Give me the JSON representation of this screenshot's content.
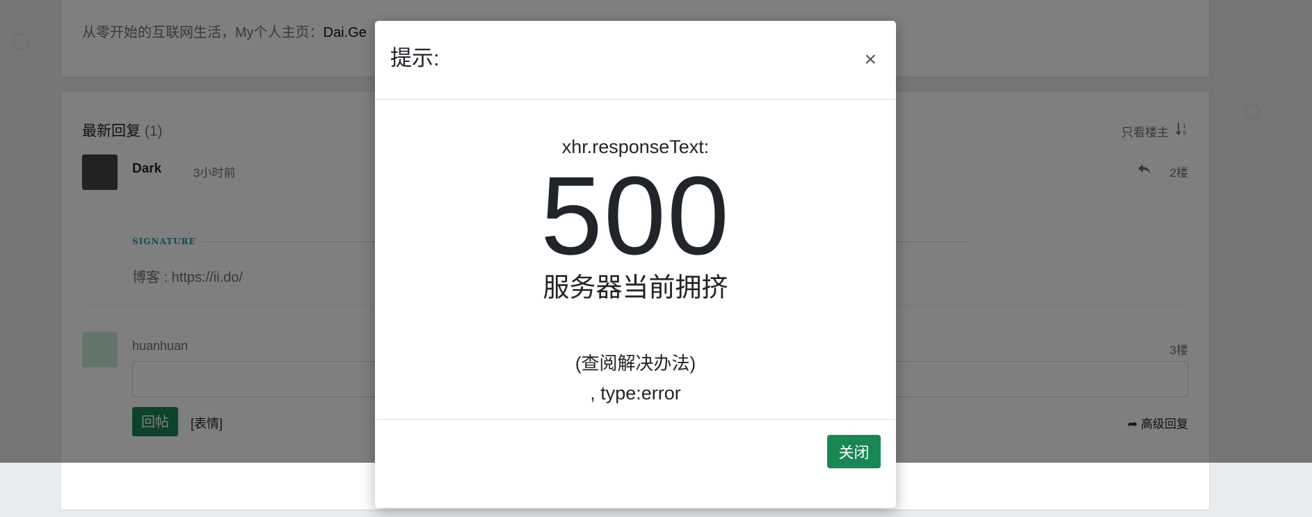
{
  "page": {
    "signature_text": "从零开始的互联网生活，My个人主页：",
    "signature_link": "Dai.Ge"
  },
  "replies": {
    "title": "最新回复",
    "count": "(1)",
    "only_owner_label": "只看楼主",
    "items": [
      {
        "user": "Dark",
        "time": "3小时前",
        "floor": "2楼",
        "signature_label": "SIGNATURE",
        "signature": "博客 : https://ii.do/"
      }
    ],
    "guest": {
      "name": "huanhuan",
      "floor": "3楼",
      "post_button": "回帖",
      "emoji_link": "[表情]",
      "advanced_reply": "高级回复"
    }
  },
  "modal": {
    "title": "提示:",
    "close_symbol": "×",
    "xhr_label": "xhr.responseText:",
    "status_code": "500",
    "status_message": "服务器当前拥挤",
    "solution_link": "(查阅解决办法)",
    "error_type": ", type:error",
    "ok_button": "关闭"
  },
  "colors": {
    "accent_green": "#198754",
    "overlay": "rgba(0,0,0,0.5)"
  }
}
